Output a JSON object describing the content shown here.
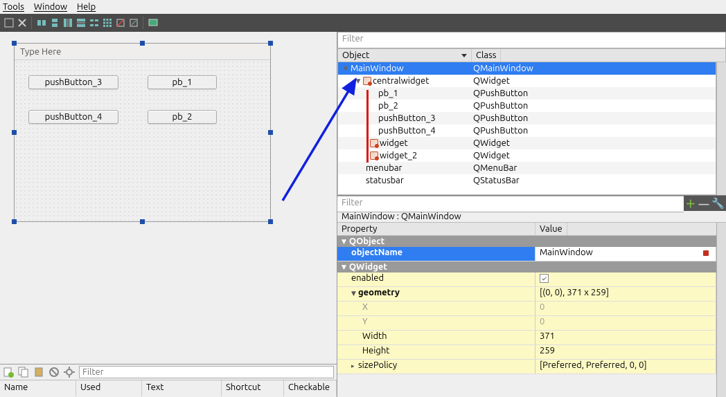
{
  "menu": {
    "tools": "Tools",
    "window": "Window",
    "help": "Help"
  },
  "form": {
    "typeHere": "Type Here",
    "btn3": "pushButton_3",
    "btn4": "pushButton_4",
    "pb1": "pb_1",
    "pb2": "pb_2"
  },
  "filterPlaceholder": "Filter",
  "objectInspector": {
    "col1": "Object",
    "col2": "Class",
    "rows": [
      {
        "name": "MainWindow",
        "cls": "QMainWindow"
      },
      {
        "name": "centralwidget",
        "cls": "QWidget"
      },
      {
        "name": "pb_1",
        "cls": "QPushButton"
      },
      {
        "name": "pb_2",
        "cls": "QPushButton"
      },
      {
        "name": "pushButton_3",
        "cls": "QPushButton"
      },
      {
        "name": "pushButton_4",
        "cls": "QPushButton"
      },
      {
        "name": "widget",
        "cls": "QWidget"
      },
      {
        "name": "widget_2",
        "cls": "QWidget"
      },
      {
        "name": "menubar",
        "cls": "QMenuBar"
      },
      {
        "name": "statusbar",
        "cls": "QStatusBar"
      }
    ]
  },
  "propContext": "MainWindow : QMainWindow",
  "propHeader": {
    "k": "Property",
    "v": "Value"
  },
  "props": {
    "qobject": "QObject",
    "objectName": "objectName",
    "objectNameVal": "MainWindow",
    "qwidget": "QWidget",
    "enabled": "enabled",
    "geometry": "geometry",
    "geometryVal": "[(0, 0), 371 x 259]",
    "x": "X",
    "xv": "0",
    "y": "Y",
    "yv": "0",
    "w": "Width",
    "wv": "371",
    "h": "Height",
    "hv": "259",
    "sizePolicy": "sizePolicy",
    "sizePolicyVal": "[Preferred, Preferred, 0, 0]"
  },
  "actions": {
    "name": "Name",
    "used": "Used",
    "text": "Text",
    "shortcut": "Shortcut",
    "checkable": "Checkable"
  }
}
